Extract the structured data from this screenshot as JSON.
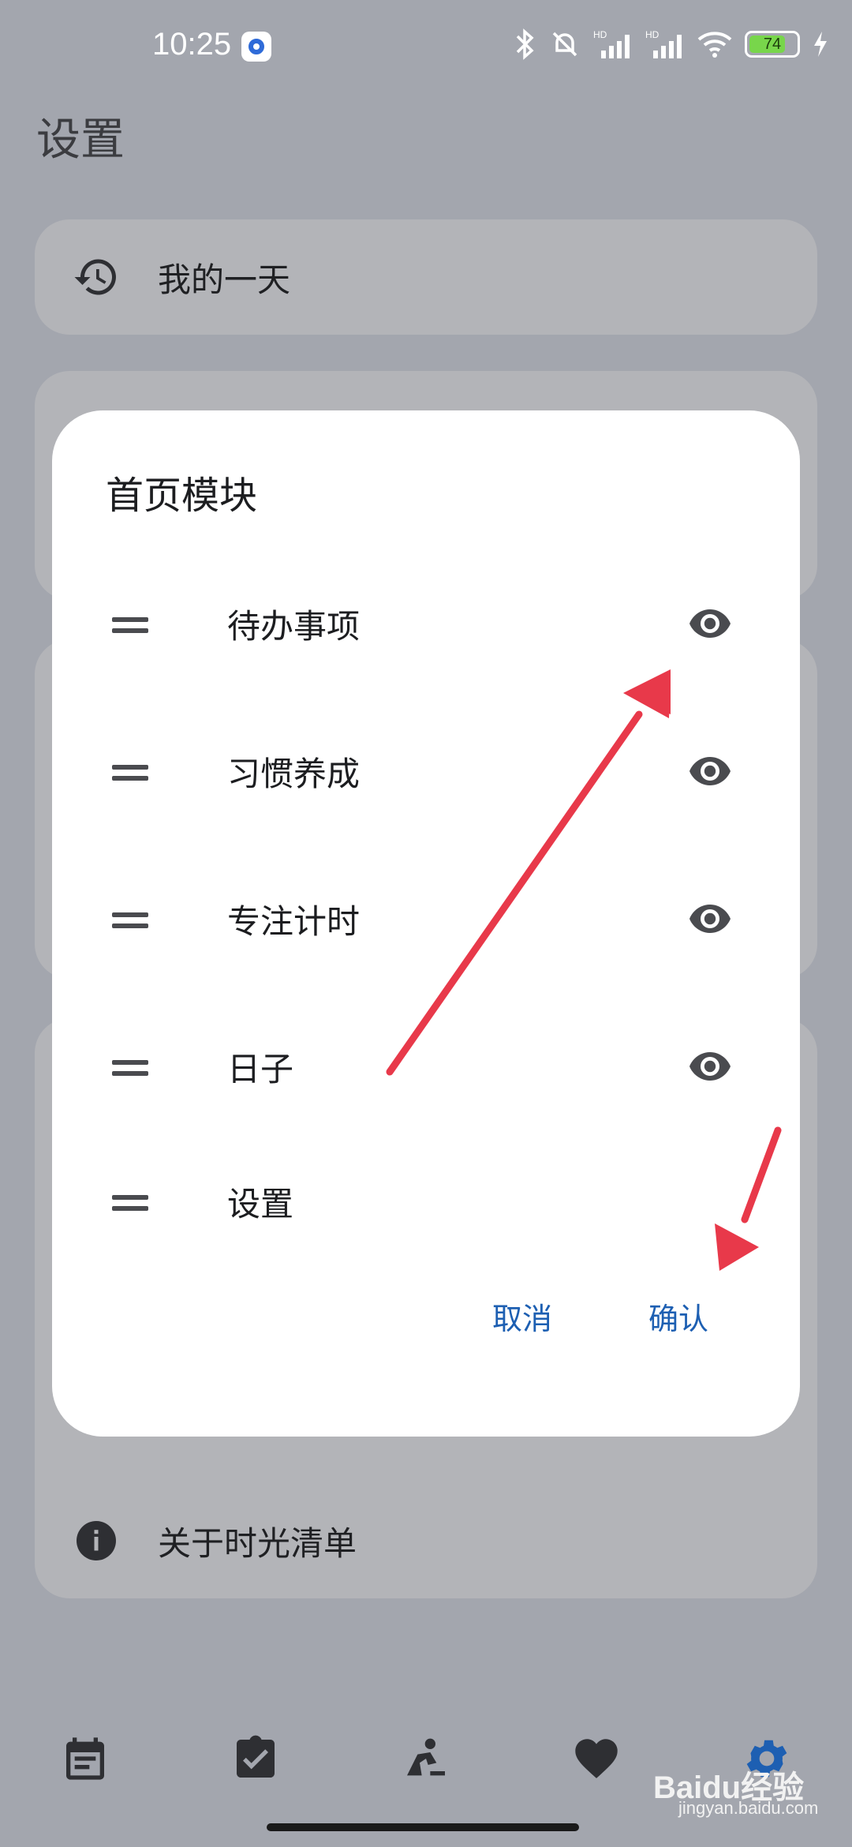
{
  "status_bar": {
    "time": "10:25",
    "battery": "74"
  },
  "page": {
    "title": "设置"
  },
  "settings": {
    "items": [
      {
        "label": "我的一天",
        "icon": "history-icon"
      },
      {
        "label": "关于时光清单",
        "icon": "info-icon"
      }
    ]
  },
  "dialog": {
    "title": "首页模块",
    "modules": [
      {
        "label": "待办事项",
        "visible": true
      },
      {
        "label": "习惯养成",
        "visible": true
      },
      {
        "label": "专注计时",
        "visible": true
      },
      {
        "label": "日子",
        "visible": true
      },
      {
        "label": "设置"
      }
    ],
    "cancel_label": "取消",
    "confirm_label": "确认"
  },
  "bottom_nav": [
    "calendar-icon",
    "checklist-icon",
    "focus-icon",
    "heart-icon",
    "gear-icon"
  ],
  "watermark": {
    "brand": "Baidu经验",
    "site": "jingyan.baidu.com"
  },
  "colors": {
    "accent": "#1d5fb2",
    "arrow": "#e8394a",
    "scrim": "#a3a6ae"
  }
}
